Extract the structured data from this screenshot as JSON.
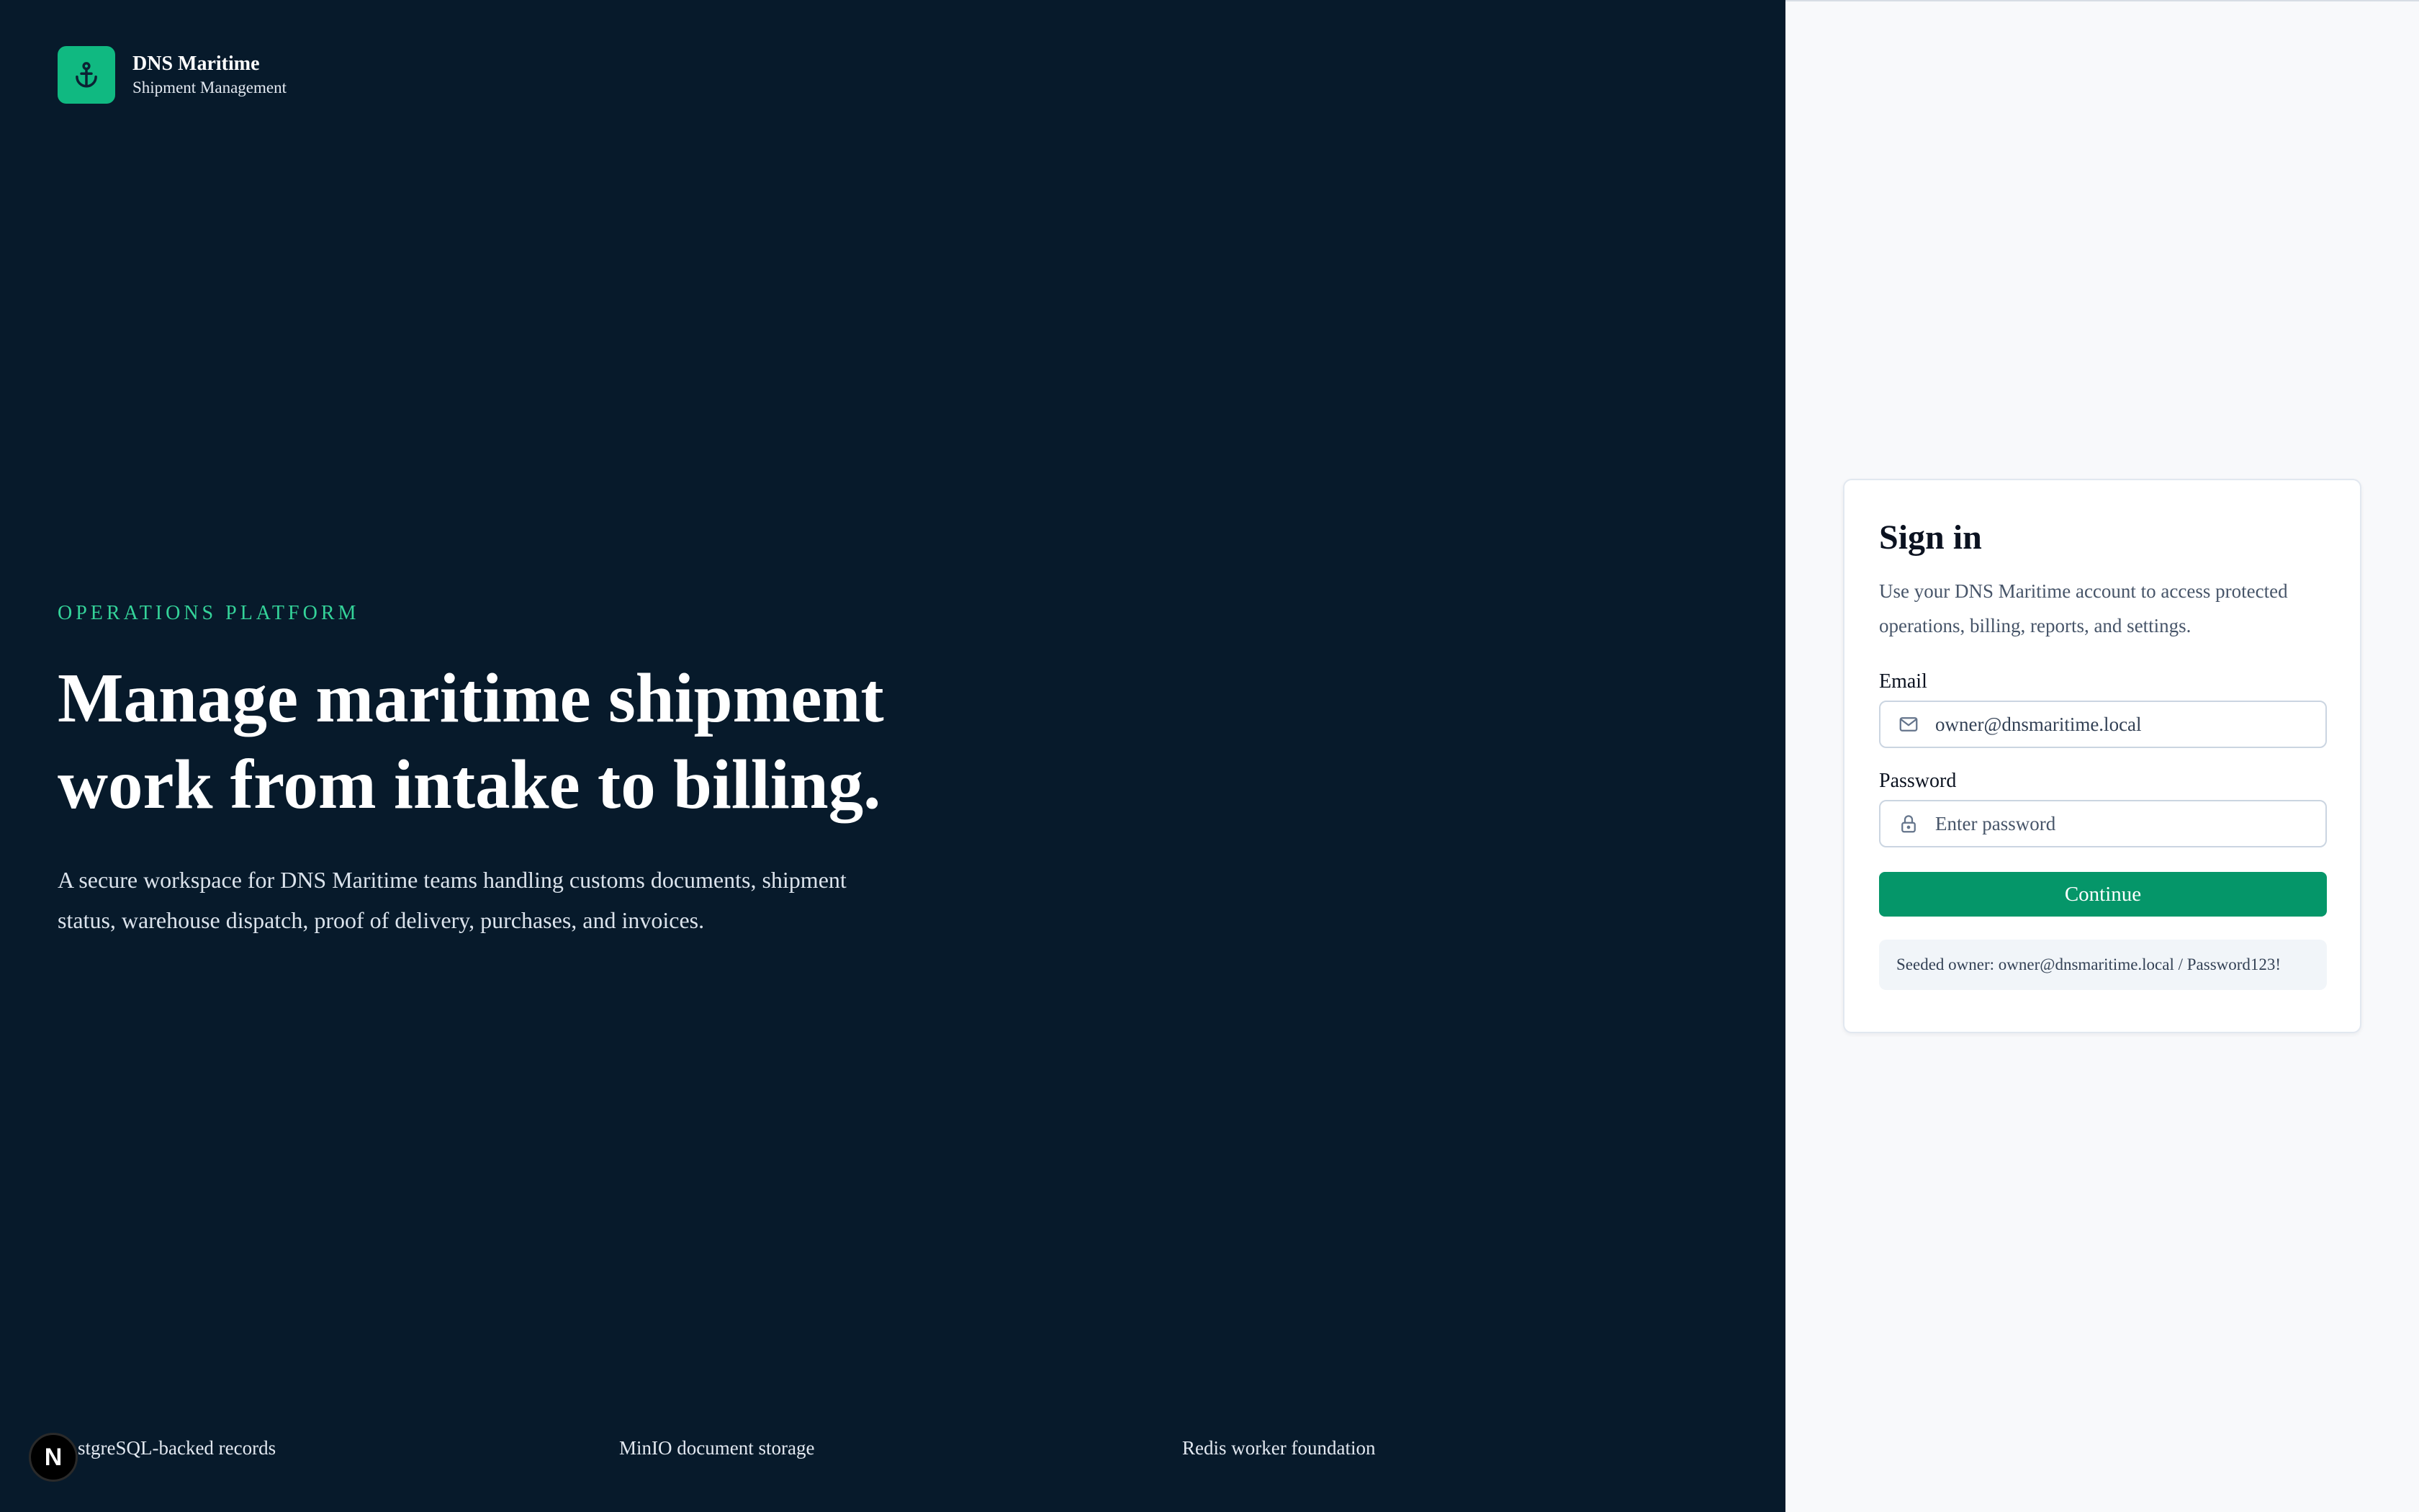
{
  "brand": {
    "name": "DNS Maritime",
    "subtitle": "Shipment Management",
    "logo_icon": "anchor-icon",
    "accent_color": "#10b981"
  },
  "hero": {
    "eyebrow": "OPERATIONS PLATFORM",
    "headline_line1": "Manage maritime shipment",
    "headline_line2": "work from intake to billing.",
    "description": "A secure workspace for DNS Maritime teams handling customs documents, shipment status, warehouse dispatch, proof of delivery, purchases, and invoices."
  },
  "features": [
    "stgreSQL-backed records",
    "MinIO document storage",
    "Redis worker foundation"
  ],
  "dev_badge": {
    "label": "N"
  },
  "signin": {
    "title": "Sign in",
    "description": "Use your DNS Maritime account to access protected operations, billing, reports, and settings.",
    "email_label": "Email",
    "email_value": "owner@dnsmaritime.local",
    "email_icon": "mail-icon",
    "password_label": "Password",
    "password_placeholder": "Enter password",
    "password_icon": "lock-icon",
    "submit_label": "Continue",
    "button_color": "#059669",
    "seed_hint": "Seeded owner: owner@dnsmaritime.local / Password123!"
  }
}
